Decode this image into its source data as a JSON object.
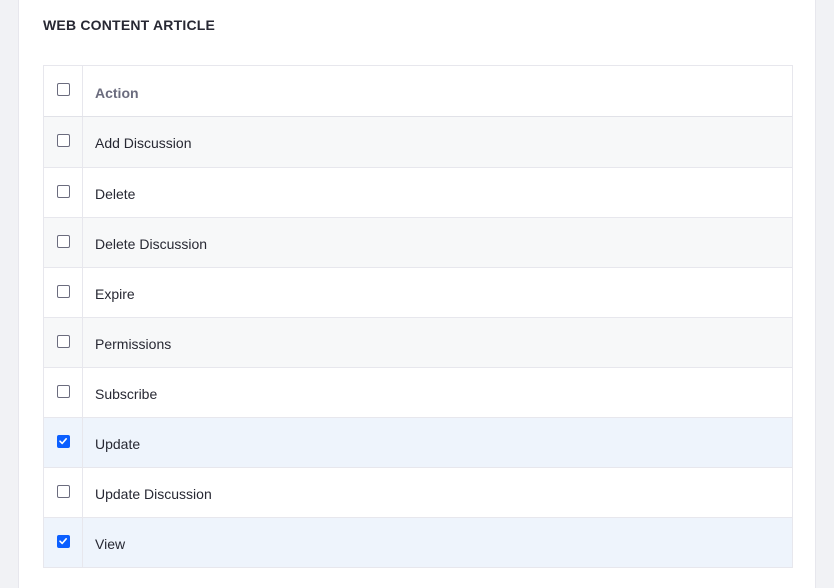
{
  "section": {
    "title": "WEB CONTENT ARTICLE"
  },
  "table": {
    "header": {
      "label": "Action",
      "checked": false
    },
    "rows": [
      {
        "label": "Add Discussion",
        "checked": false
      },
      {
        "label": "Delete",
        "checked": false
      },
      {
        "label": "Delete Discussion",
        "checked": false
      },
      {
        "label": "Expire",
        "checked": false
      },
      {
        "label": "Permissions",
        "checked": false
      },
      {
        "label": "Subscribe",
        "checked": false
      },
      {
        "label": "Update",
        "checked": true
      },
      {
        "label": "Update Discussion",
        "checked": false
      },
      {
        "label": "View",
        "checked": true
      }
    ]
  },
  "colors": {
    "accent": "#0b5fff",
    "selected_row": "#eef4fc",
    "striped_row": "#f7f8f9"
  },
  "icons": {
    "checkbox_checked": "checkmark-icon"
  }
}
